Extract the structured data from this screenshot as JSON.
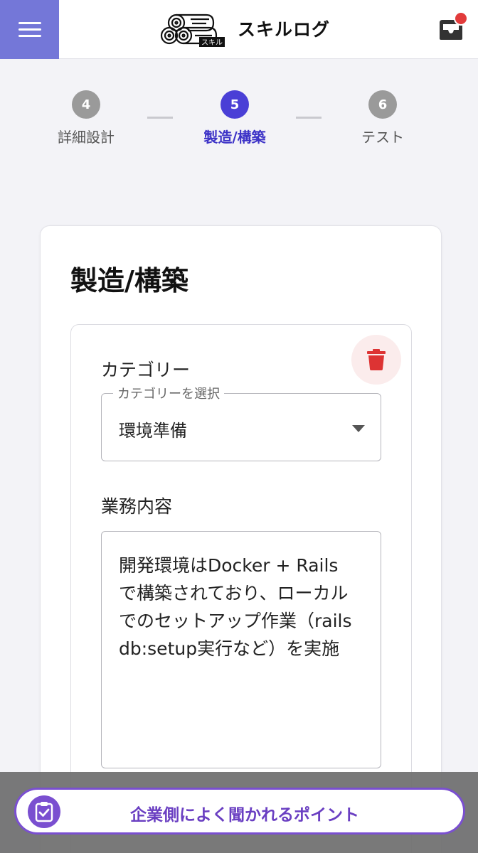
{
  "header": {
    "title": "スキルログ",
    "logo_badge": "スキル",
    "menu_icon": "hamburger-menu-icon",
    "inbox_icon": "inbox-icon",
    "accent_color": "#7477d8",
    "notification_color": "#e23b3b"
  },
  "stepper": {
    "steps": [
      {
        "number": "4",
        "label": "詳細設計",
        "active": false
      },
      {
        "number": "5",
        "label": "製造/構築",
        "active": true
      },
      {
        "number": "6",
        "label": "テスト",
        "active": false
      }
    ],
    "active_color": "#4a3fd6"
  },
  "card": {
    "title": "製造/構築",
    "category_label": "カテゴリー",
    "category_select": {
      "legend": "カテゴリーを選択",
      "value": "環境準備"
    },
    "content_label": "業務内容",
    "content_lines": [
      "開発環境はDocker + Rails",
      "で構築されており、ローカル",
      "でのセットアップ作業（rails",
      "db:setup実行など）を実施"
    ],
    "delete_icon": "trash-icon"
  },
  "bottom": {
    "button_label": "企業側によく聞かれるポイント",
    "button_icon": "clipboard-check-icon",
    "button_color": "#7a4fd0"
  }
}
